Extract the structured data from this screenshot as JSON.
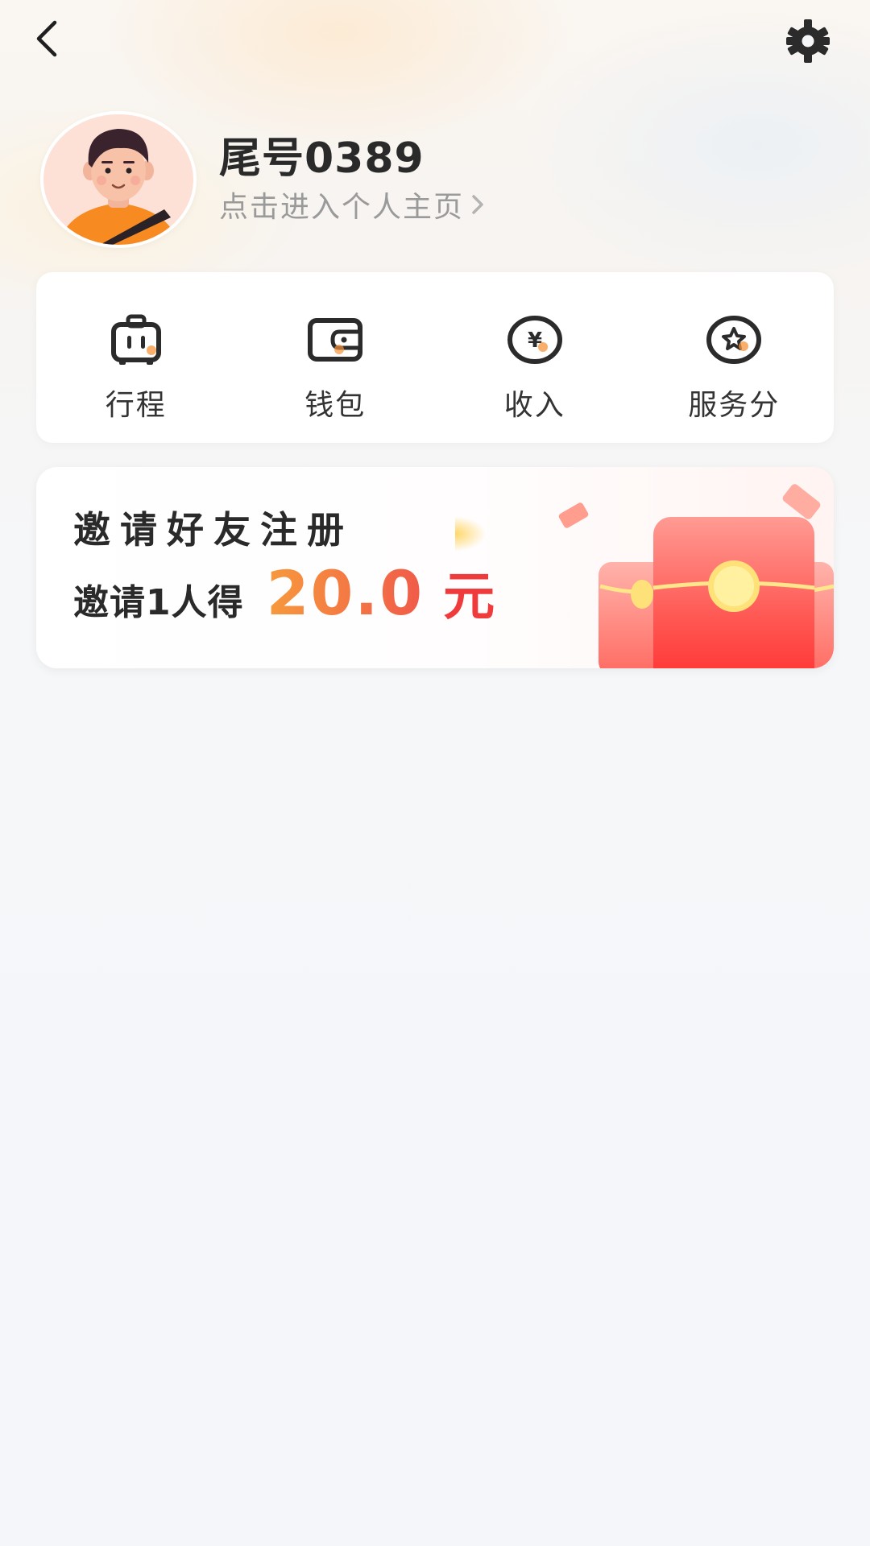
{
  "header": {
    "back_icon": "chevron-left-icon",
    "settings_icon": "gear-icon"
  },
  "profile": {
    "name": "尾号0389",
    "link_text": "点击进入个人主页",
    "avatar": "avatar-illustration",
    "link_icon": "chevron-right-icon"
  },
  "menu": {
    "items": [
      {
        "label": "行程",
        "icon": "luggage-icon"
      },
      {
        "label": "钱包",
        "icon": "wallet-icon"
      },
      {
        "label": "收入",
        "icon": "yen-coin-icon"
      },
      {
        "label": "服务分",
        "icon": "star-badge-icon"
      }
    ]
  },
  "promo": {
    "title": "邀请好友注册",
    "prefix": "邀请1人得",
    "amount": "20.0",
    "unit": "元",
    "art": "red-envelope-illustration"
  },
  "colors": {
    "accent_orange": "#f7943a",
    "accent_red": "#ef3b3b",
    "icon_dark": "#2b2b2b",
    "text_gray": "#9a9a9a"
  }
}
